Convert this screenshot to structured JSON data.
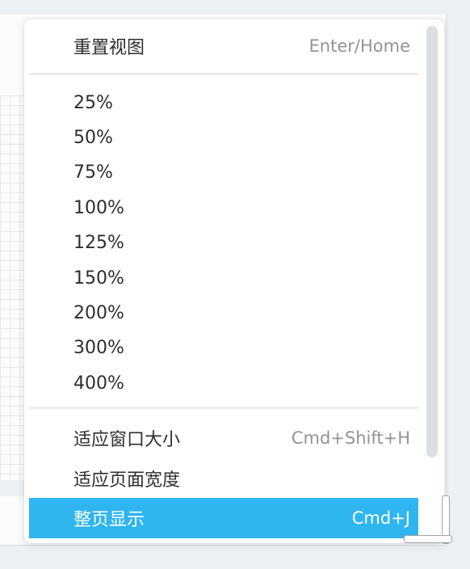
{
  "menu": {
    "reset_view": {
      "label": "重置视图",
      "shortcut": "Enter/Home"
    },
    "zoom_levels": [
      "25%",
      "50%",
      "75%",
      "100%",
      "125%",
      "150%",
      "200%",
      "300%",
      "400%"
    ],
    "fit_window": {
      "label": "适应窗口大小",
      "shortcut": "Cmd+Shift+H"
    },
    "fit_width": {
      "label": "适应页面宽度",
      "shortcut": ""
    },
    "fit_page": {
      "label": "整页显示",
      "shortcut": "Cmd+J"
    }
  },
  "colors": {
    "highlight": "#2fb5ef",
    "text": "#2b2f33",
    "shortcut": "#8f9499"
  }
}
